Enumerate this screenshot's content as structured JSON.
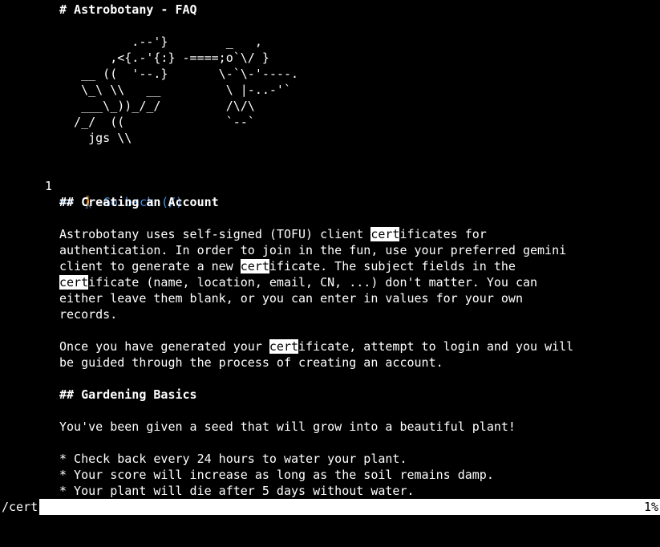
{
  "page": {
    "title": "# Astrobotany - FAQ",
    "ascii_art": [
      "          .--'}        _   ,",
      "       ,<{.-'{:} -====;o`\\/ }",
      "   __ ((  '--.}       \\-`\\-'----.",
      "   \\_\\ \\\\   __         \\ |-..-'`",
      "   ___\\_))_/_/         /\\/\\",
      "  /_/  ((              `--`",
      "    jgs \\\\"
    ],
    "link": {
      "number": "1",
      "text": "=> 🚶 Go back (/)"
    },
    "section_account": {
      "heading": "## Creating an Account",
      "para1": [
        [
          "Astrobotany uses self-signed (TOFU) client ",
          "cert",
          "ificates for"
        ],
        [
          "authentication. In order to join in the fun, use your preferred gemini"
        ],
        [
          "client to generate a new ",
          "cert",
          "ificate. The subject fields in the"
        ],
        [
          "",
          "cert",
          "ificate (name, location, email, CN, ...) don't matter. You can"
        ],
        [
          "either leave them blank, or you can enter in values for your own"
        ],
        [
          "records."
        ]
      ],
      "para2": [
        [
          "Once you have generated your ",
          "cert",
          "ificate, attempt to login and you will"
        ],
        [
          "be guided through the process of creating an account."
        ]
      ]
    },
    "section_gardening": {
      "heading": "## Gardening Basics",
      "intro": "You've been given a seed that will grow into a beautiful plant!",
      "bullets": [
        "* Check back every 24 hours to water your plant.",
        "* Your score will increase as long as the soil remains damp.",
        "* Your plant will die after 5 days without water."
      ]
    }
  },
  "statusbar": {
    "command": "/cert",
    "percent": "1%"
  }
}
